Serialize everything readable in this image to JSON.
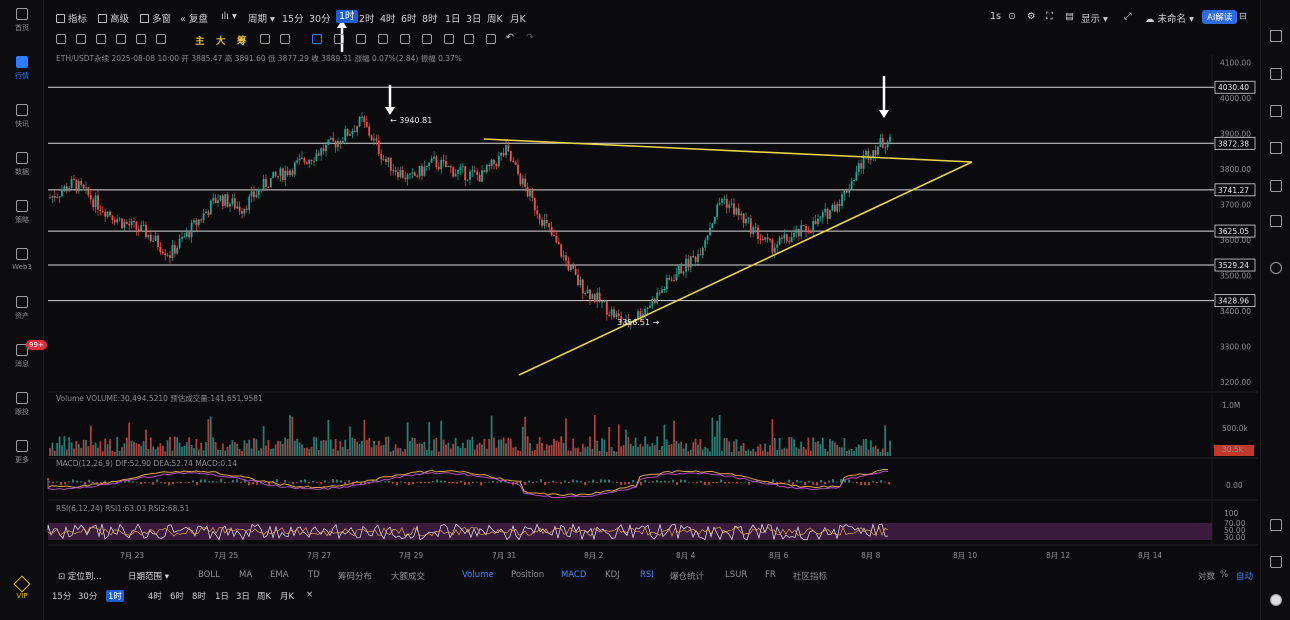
{
  "left_nav": [
    {
      "label": "首页",
      "icon": "home-icon",
      "active": false
    },
    {
      "label": "行情",
      "icon": "chart-icon",
      "active": true
    },
    {
      "label": "快讯",
      "icon": "news-icon",
      "active": false
    },
    {
      "label": "数据",
      "icon": "data-icon",
      "active": false
    },
    {
      "label": "策略",
      "icon": "strategy-icon",
      "active": false
    },
    {
      "label": "Web3",
      "icon": "web3-icon",
      "active": false
    },
    {
      "label": "资产",
      "icon": "wallet-icon",
      "active": false
    },
    {
      "label": "消息",
      "icon": "message-icon",
      "active": false,
      "badge": "99+"
    },
    {
      "label": "跟投",
      "icon": "copy-icon",
      "active": false
    },
    {
      "label": "更多",
      "icon": "more-icon",
      "active": false
    }
  ],
  "vip_label": "VIP",
  "top_toolbar": {
    "indicators": "指标",
    "advanced": "高级",
    "multi": "多窗",
    "replay": "复盘",
    "period": "周期",
    "intervals": [
      "15分",
      "30分",
      "1时",
      "2时",
      "4时",
      "6时",
      "8时",
      "1日",
      "3日",
      "周K",
      "月K"
    ],
    "selected_interval": "1时",
    "speed": "1s",
    "display": "显示",
    "login": "未命名",
    "ai": "AI解读"
  },
  "draw_toolbar": {
    "main": "主",
    "big": "大",
    "chip": "筹"
  },
  "info_line": {
    "symbol": "ETH/USDT永续",
    "time": "2025-08-08 10:00",
    "open": "开 3885.47",
    "high": "高 3891.60",
    "low": "低 3877.29",
    "close": "收 3889.31",
    "change": "涨幅 0.07%(2.84)",
    "amplitude": "振幅 0.37%"
  },
  "volume_label": "Volume  VOLUME:30,494.5210  预估成交量:141,651.9581",
  "macd_label": "MACD(12,26,9)  DIF:52.90  DEA:52.74  MACD:0.14",
  "rsi_label": "RSI(6,12,24)  RSI1:63.03  RSI2:68.51",
  "chart_data": {
    "type": "candlestick",
    "symbol": "ETH/USDT",
    "interval": "1h",
    "y_axis_ticks": [
      3200,
      3300,
      3400,
      3500,
      3600,
      3700,
      3800,
      3900,
      4000,
      4100
    ],
    "y_axis_tick_labels": [
      "3200.00",
      "3300.00",
      "3400.00",
      "3500.00",
      "3600.00",
      "3700.00",
      "3800.00",
      "3900.00",
      "4000.00",
      "4100.00"
    ],
    "x_axis_ticks": [
      "7月 23",
      "7月 25",
      "7月 27",
      "7月 29",
      "7月 31",
      "8月 2",
      "8月 4",
      "8月 6",
      "8月 8",
      "8月 10",
      "8月 12",
      "8月 14"
    ],
    "horizontal_levels": [
      {
        "value": 4030.4,
        "label": "4030.40"
      },
      {
        "value": 3872.38,
        "label": "3872.38"
      },
      {
        "value": 3741.27,
        "label": "3741.27"
      },
      {
        "value": 3625.05,
        "label": "3625.05"
      },
      {
        "value": 3529.24,
        "label": "3529.24"
      },
      {
        "value": 3428.96,
        "label": "3428.96"
      }
    ],
    "annotations": [
      {
        "label": "3940.81",
        "type": "high"
      },
      {
        "label": "3356.51",
        "type": "low"
      }
    ],
    "close_path": [
      [
        "7月22",
        3720
      ],
      [
        "7月22",
        3760
      ],
      [
        "7月23",
        3700
      ],
      [
        "7月23",
        3650
      ],
      [
        "7月24",
        3620
      ],
      [
        "7月24",
        3560
      ],
      [
        "7月25",
        3640
      ],
      [
        "7月25",
        3720
      ],
      [
        "7月26",
        3690
      ],
      [
        "7月26",
        3760
      ],
      [
        "7月27",
        3800
      ],
      [
        "7月27",
        3840
      ],
      [
        "7月28",
        3880
      ],
      [
        "7月28",
        3935
      ],
      [
        "7月29",
        3820
      ],
      [
        "7月29",
        3770
      ],
      [
        "7月30",
        3820
      ],
      [
        "7月30",
        3790
      ],
      [
        "7月31",
        3780
      ],
      [
        "7月31",
        3850
      ],
      [
        "8月1",
        3720
      ],
      [
        "8月1",
        3600
      ],
      [
        "8月2",
        3480
      ],
      [
        "8月2",
        3420
      ],
      [
        "8月3",
        3360
      ],
      [
        "8月3",
        3420
      ],
      [
        "8月4",
        3500
      ],
      [
        "8月4",
        3560
      ],
      [
        "8月5",
        3720
      ],
      [
        "8月5",
        3650
      ],
      [
        "8月6",
        3580
      ],
      [
        "8月6",
        3610
      ],
      [
        "8月7",
        3650
      ],
      [
        "8月7",
        3720
      ],
      [
        "8月7",
        3840
      ],
      [
        "8月8",
        3889
      ]
    ],
    "trendlines": [
      {
        "name": "resistance",
        "from": [
          "7月30",
          3875
        ],
        "to": [
          "8月9",
          3820
        ]
      },
      {
        "name": "support",
        "from": [
          "7月31",
          3200
        ],
        "to": [
          "8月9",
          3820
        ]
      }
    ],
    "volume_axis": [
      "1.0M",
      "500.0k",
      "30.5k"
    ],
    "macd_axis": [
      "0.00"
    ],
    "rsi_axis": [
      "100",
      "70.00",
      "50.00",
      "30.00"
    ]
  },
  "bottom_tabs": {
    "locate": "定位到...",
    "date_range": "日期范围",
    "items": [
      "BOLL",
      "MA",
      "EMA",
      "TD",
      "筹码分布",
      "大额成交",
      "Volume",
      "Position",
      "MACD",
      "KDJ",
      "RSI",
      "爆仓统计",
      "LSUR",
      "FR",
      "社区指标"
    ],
    "active": [
      "Volume",
      "MACD",
      "RSI"
    ],
    "log": "对数",
    "percent": "%",
    "auto": "自动"
  },
  "bottom_intervals": [
    "15分",
    "30分",
    "1时",
    "4时",
    "6时",
    "8时",
    "1日",
    "3日",
    "周K",
    "月K"
  ],
  "bottom_selected": "1时",
  "colors": {
    "up": "#26a69a",
    "down": "#ef5350",
    "trend": "#e8d34a",
    "accent": "#2f7bff",
    "rsi_band": "#3a1a3d"
  }
}
